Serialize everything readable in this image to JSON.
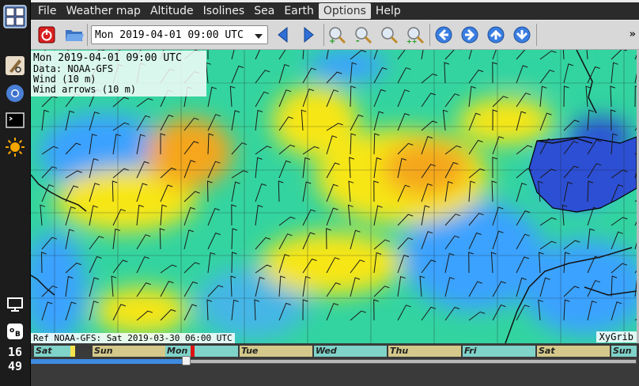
{
  "clock": {
    "hour": "16",
    "minute": "49"
  },
  "menu": [
    "File",
    "Weather map",
    "Altitude",
    "Isolines",
    "Sea",
    "Earth",
    "Options",
    "Help"
  ],
  "menu_active": "Options",
  "toolbar": {
    "date_value": "Mon 2019-04-01 09:00 UTC",
    "overflow": "»"
  },
  "map": {
    "info": {
      "date": "Mon 2019-04-01 09:00 UTC",
      "data": "Data: NOAA-GFS",
      "wind": "Wind (10 m)",
      "arrows": "Wind arrows (10 m)"
    },
    "ref": "Ref NOAA-GFS: Sat 2019-03-30 06:00 UTC",
    "brand": "XyGrib"
  },
  "timeline": {
    "days": [
      "Sat",
      "Sun",
      "Mon",
      "Tue",
      "Wed",
      "Thu",
      "Fri",
      "Sat",
      "Sun"
    ],
    "progress": 0.27
  },
  "colors": {
    "accent": "#3d8be0",
    "wind_slow": "#3aa2ff",
    "wind_mid": "#33d4a0",
    "wind_fast": "#f7e617",
    "wind_max": "#f5a61c",
    "land": "#2c4fd4"
  },
  "icons": {
    "app": "xygrib-app-icon",
    "dock": [
      "gimp-icon",
      "chromium-icon",
      "terminal-icon",
      "weather-icon",
      "display-icon",
      "keyboard-icon"
    ],
    "toolbar": [
      "stop-icon",
      "open-folder-icon",
      "prev-arrow-icon",
      "next-arrow-icon",
      "zoom-in-icon",
      "zoom-out-icon",
      "zoom-fit-icon",
      "zoom-all-icon",
      "pan-left-icon",
      "pan-right-icon",
      "pan-up-icon",
      "pan-down-icon"
    ]
  }
}
